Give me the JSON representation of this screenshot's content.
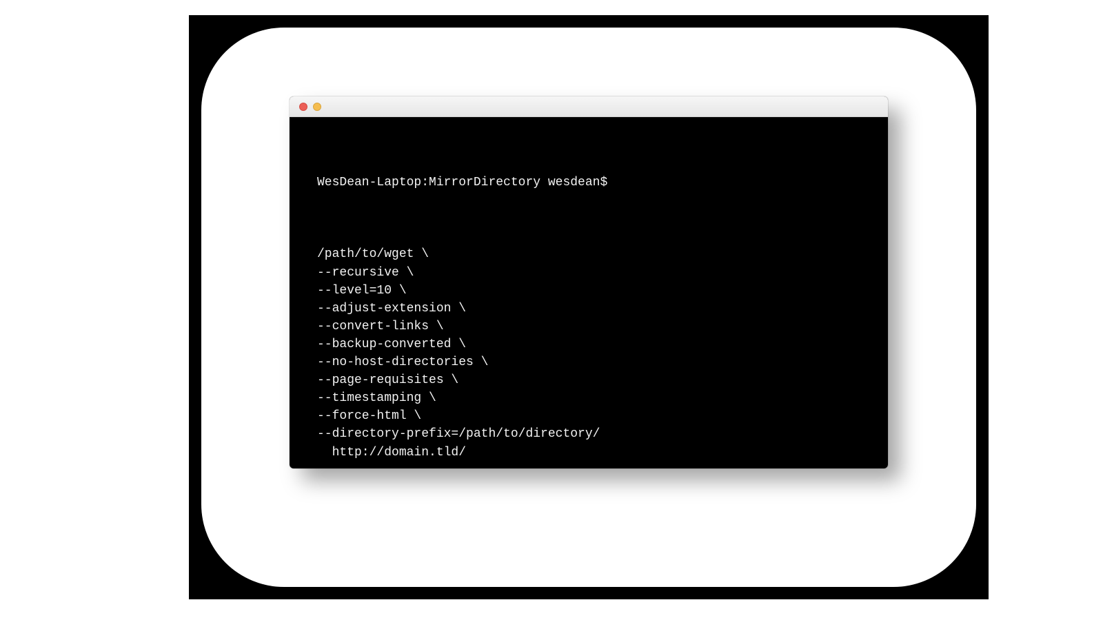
{
  "terminal": {
    "prompt": "WesDean-Laptop:MirrorDirectory wesdean$",
    "command_lines": [
      "/path/to/wget \\",
      "--recursive \\",
      "--level=10 \\",
      "--adjust-extension \\",
      "--convert-links \\",
      "--backup-converted \\",
      "--no-host-directories \\",
      "--page-requisites \\",
      "--timestamping \\",
      "--force-html \\",
      "--directory-prefix=/path/to/directory/",
      "  http://domain.tld/"
    ],
    "next_prompt": ">"
  }
}
